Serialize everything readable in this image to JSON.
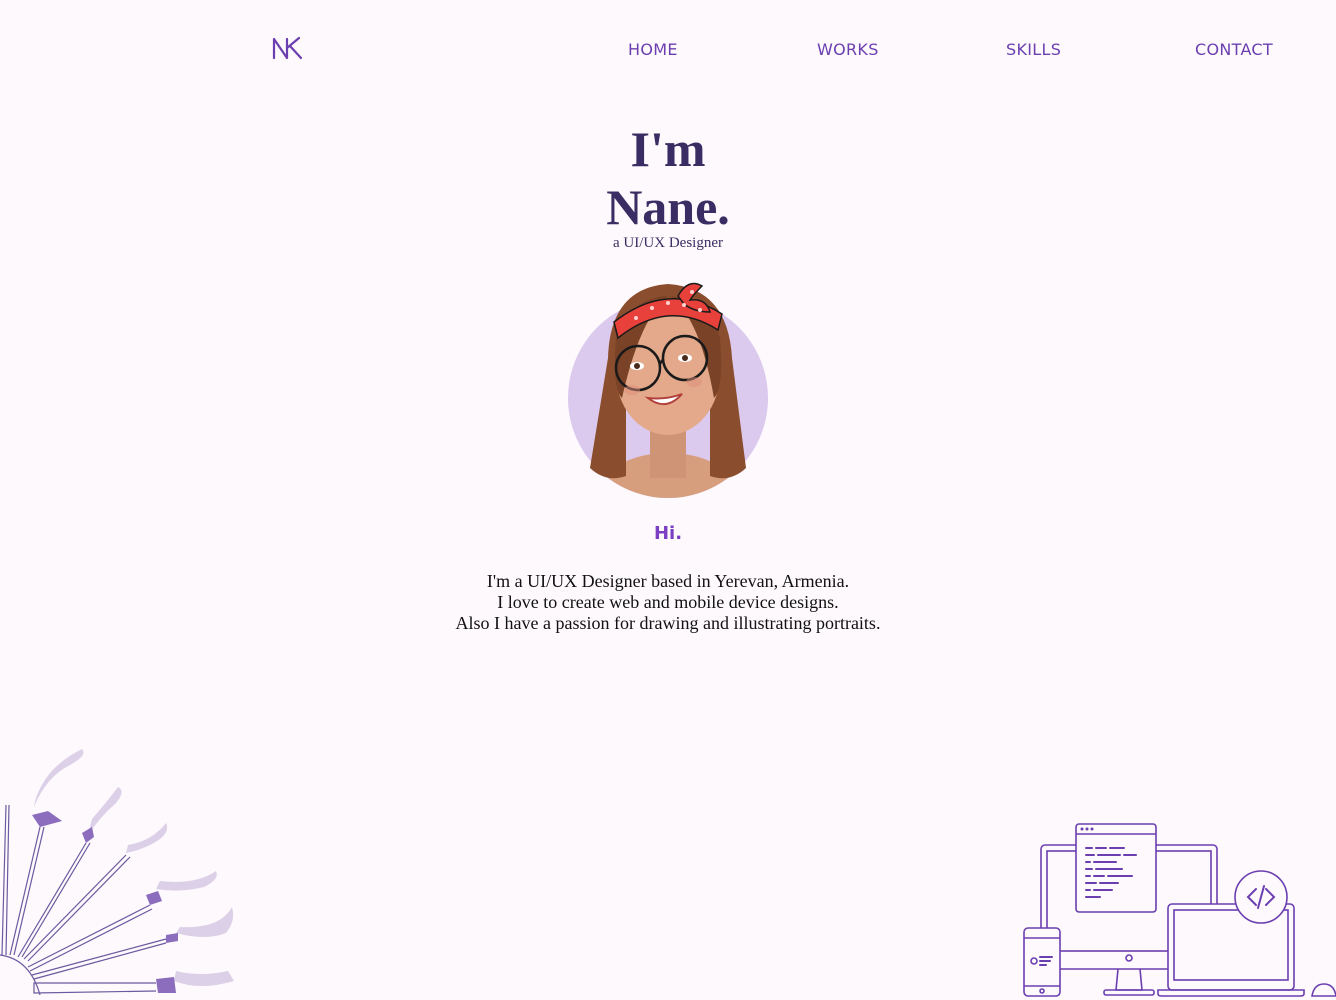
{
  "header": {
    "logo_text": "NK",
    "nav": [
      {
        "label": "HOME"
      },
      {
        "label": "WORKS"
      },
      {
        "label": "SKILLS"
      },
      {
        "label": "CONTACT"
      }
    ]
  },
  "hero": {
    "line1": "I'm",
    "line2": "Nane.",
    "subtitle": "a UI/UX Designer"
  },
  "intro": {
    "greeting": "Hi.",
    "lines": [
      "I'm a UI/UX Designer based in Yerevan, Armenia.",
      "I love to create web and mobile device designs.",
      "Also I have a passion for drawing and illustrating portraits."
    ]
  },
  "colors": {
    "accent": "#6b3fb0",
    "heading": "#3a2d63",
    "avatar_bg": "#dcc9ee",
    "background": "#fdf9fc"
  },
  "icons": [
    "logo",
    "avatar-illustration",
    "paint-brushes-illustration",
    "devices-illustration",
    "code-icon"
  ]
}
